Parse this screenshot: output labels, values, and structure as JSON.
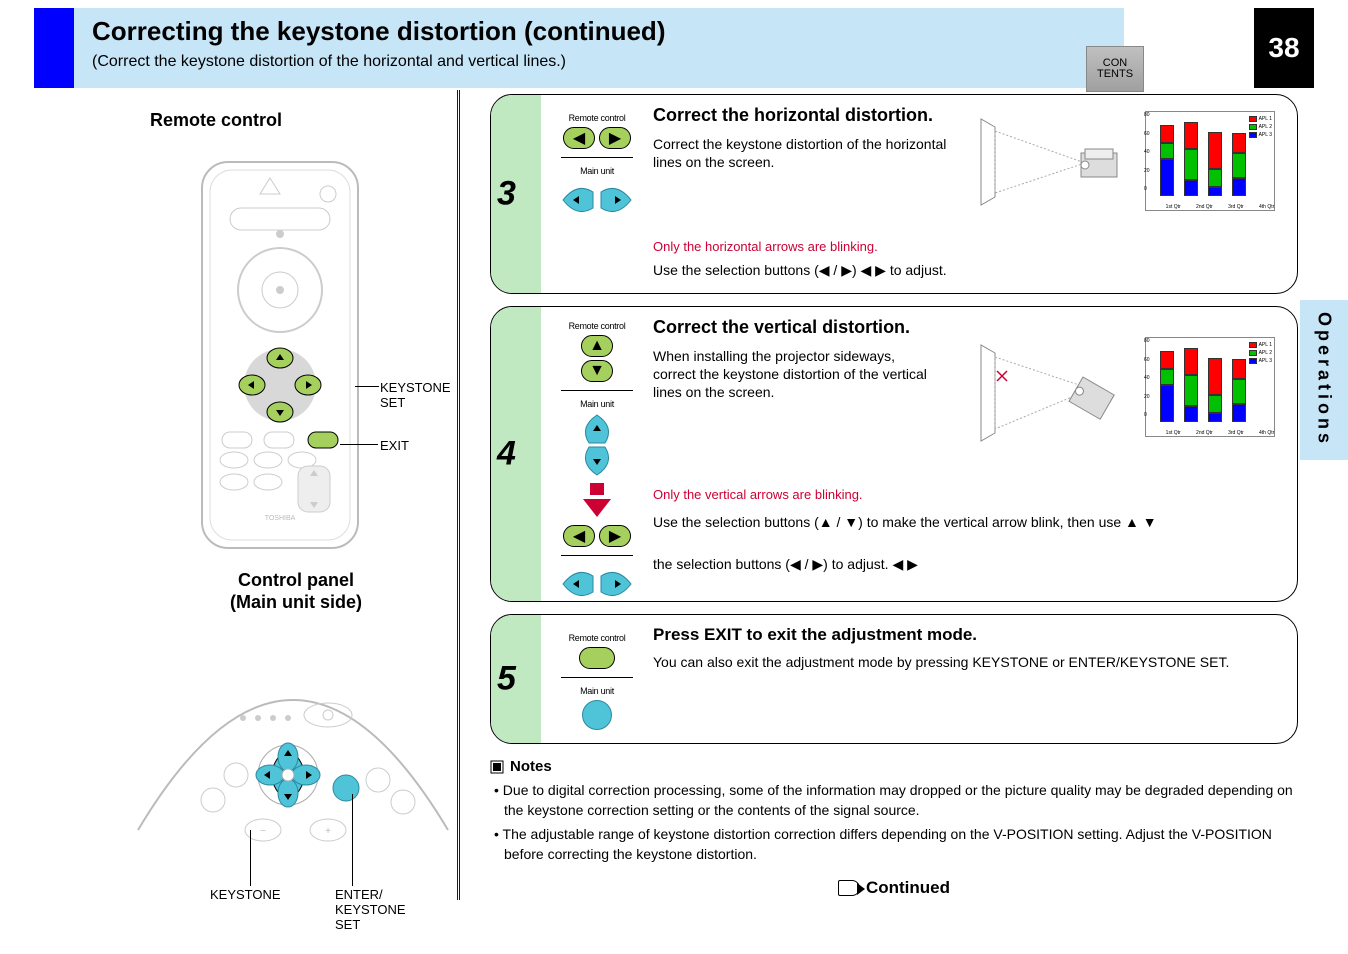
{
  "page_number": "38",
  "header": {
    "title": "Correcting the keystone distortion (continued)",
    "subtitle": "(Correct the keystone distortion of the horizontal and vertical lines.)",
    "contents_button": "CON TENTS"
  },
  "side_tab": "Operations",
  "left": {
    "remote_label": "Remote control",
    "keystone_set": "KEYSTONE\nSET",
    "exit_label": "EXIT",
    "panel_label": "Control panel\n(Main unit side)",
    "keystone_label": "KEYSTONE",
    "enter_label": "ENTER/\nKEYSTONE\nSET"
  },
  "step3": {
    "num": "3",
    "title": "Correct the horizontal distortion.",
    "line1": "Correct the keystone distortion of the horizontal",
    "line2": "lines on the screen.",
    "foot": "to adjust.",
    "blink": "Only the horizontal arrows are blinking.",
    "rc": "Remote control",
    "mu": "Main unit",
    "lr_hint": "Use the selection buttons (◀ / ▶)"
  },
  "step4": {
    "num": "4",
    "title": "Correct the vertical distortion.",
    "line1": "When installing the projector sideways,",
    "line2": "correct the keystone distortion of the vertical",
    "line3": "lines on the screen.",
    "midline1": "Use the selection buttons (▲ / ▼) to make the vertical arrow blink, then use",
    "midline2": "the selection buttons (◀ / ▶) to adjust.",
    "blink": "Only the vertical arrows are blinking.",
    "rc": "Remote control",
    "mu": "Main unit"
  },
  "step5": {
    "num": "5",
    "title": "Press EXIT to exit the adjustment mode.",
    "sub": "You can also exit the adjustment mode by pressing KEYSTONE or ENTER/KEYSTONE SET.",
    "rc": "Remote control",
    "mu": "Main unit"
  },
  "notes": {
    "title": "Notes",
    "n1": "• Due to digital correction processing, some of the information may dropped or the picture quality may be degraded depending on the keystone correction setting or the contents of the signal source.",
    "n2": "• The adjustable range of keystone distortion correction differs depending on the V-POSITION setting. Adjust the V-POSITION before correcting the keystone distortion.",
    "continued": "Continued"
  },
  "chart_data": {
    "type": "bar",
    "categories": [
      "1st Qtr",
      "2nd Qtr",
      "3rd Qtr",
      "4th Qtr"
    ],
    "ylim": [
      0,
      90
    ],
    "yticks": [
      0,
      20,
      40,
      60,
      80
    ],
    "series": [
      {
        "name": "APL 1",
        "color": "#ff0000",
        "values": [
          20,
          30,
          42,
          23
        ]
      },
      {
        "name": "APL 2",
        "color": "#00c000",
        "values": [
          18,
          35,
          20,
          28
        ]
      },
      {
        "name": "APL 3",
        "color": "#0000ff",
        "values": [
          42,
          18,
          10,
          20
        ]
      }
    ]
  }
}
